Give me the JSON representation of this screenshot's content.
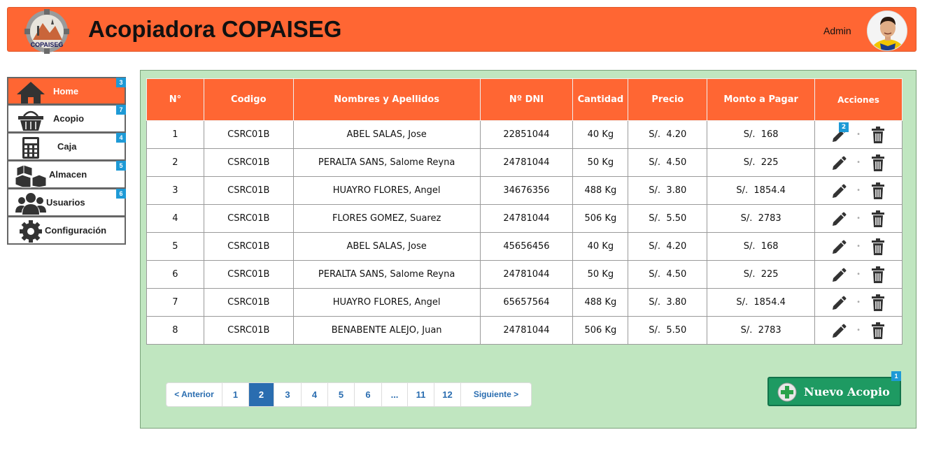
{
  "header": {
    "title": "Acopiadora COPAISEG",
    "logo_text": "COPAISEG",
    "user_name": "Admin",
    "brand_color": "#ff6633"
  },
  "sidebar": {
    "items": [
      {
        "label": "Home",
        "icon": "home-icon",
        "badge": "3",
        "active": true
      },
      {
        "label": "Acopio",
        "icon": "basket-icon",
        "badge": "7",
        "active": false
      },
      {
        "label": "Caja",
        "icon": "calculator-icon",
        "badge": "4",
        "active": false
      },
      {
        "label": "Almacen",
        "icon": "boxes-icon",
        "badge": "5",
        "active": false
      },
      {
        "label": "Usuarios",
        "icon": "users-icon",
        "badge": "6",
        "active": false
      },
      {
        "label": "Configuración",
        "icon": "gear-icon",
        "badge": "",
        "active": false
      }
    ]
  },
  "table": {
    "columns": [
      "N°",
      "Codigo",
      "Nombres y Apellidos",
      "Nº DNI",
      "Cantidad",
      "Precio",
      "Monto a Pagar",
      "Acciones"
    ],
    "rows": [
      [
        "1",
        "CSRC01B",
        "ABEL SALAS, Jose",
        "22851044",
        "40 Kg",
        "S/.  4.20",
        "S/.  168"
      ],
      [
        "2",
        "CSRC01B",
        "PERALTA SANS, Salome Reyna",
        "24781044",
        "50 Kg",
        "S/.  4.50",
        "S/.  225"
      ],
      [
        "3",
        "CSRC01B",
        "HUAYRO FLORES, Angel",
        "34676356",
        "488 Kg",
        "S/.  3.80",
        "S/.  1854.4"
      ],
      [
        "4",
        "CSRC01B",
        "FLORES GOMEZ, Suarez",
        "24781044",
        "506 Kg",
        "S/.  5.50",
        "S/.  2783"
      ],
      [
        "5",
        "CSRC01B",
        "ABEL SALAS, Jose",
        "45656456",
        "40 Kg",
        "S/.  4.20",
        "S/.  168"
      ],
      [
        "6",
        "CSRC01B",
        "PERALTA SANS, Salome Reyna",
        "24781044",
        "50 Kg",
        "S/.  4.50",
        "S/.  225"
      ],
      [
        "7",
        "CSRC01B",
        "HUAYRO FLORES, Angel",
        "65657564",
        "488 Kg",
        "S/.  3.80",
        "S/.  1854.4"
      ],
      [
        "8",
        "CSRC01B",
        "BENABENTE ALEJO, Juan",
        "24781044",
        "506 Kg",
        "S/.  5.50",
        "S/.  2783"
      ]
    ],
    "action_badge": "2"
  },
  "pagination": {
    "prev_label": "< Anterior",
    "next_label": "Siguiente >",
    "pages": [
      "1",
      "2",
      "3",
      "4",
      "5",
      "6",
      "...",
      "11",
      "12"
    ],
    "current": "2"
  },
  "new_button": {
    "label": "Nuevo Acopio",
    "badge": "1",
    "color": "#1e9a62"
  },
  "panel_color": "#c0e6c0"
}
